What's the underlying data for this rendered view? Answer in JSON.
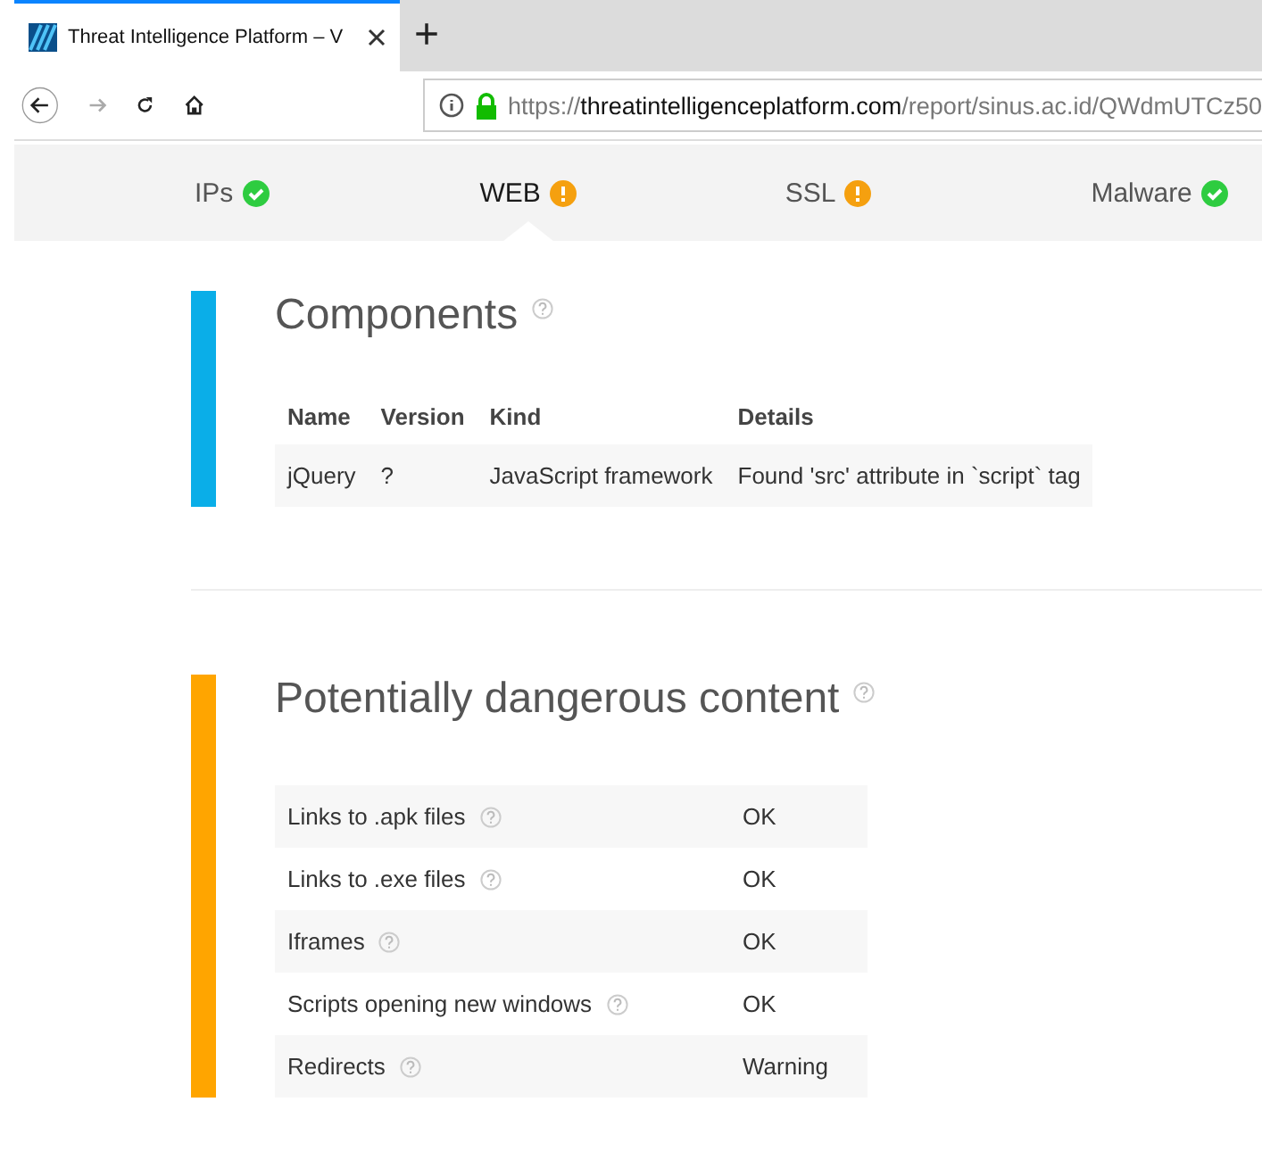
{
  "browser": {
    "tab_title": "Threat Intelligence Platform – V",
    "new_tab": "+",
    "url": {
      "scheme": "https://",
      "host": "threatintelligenceplatform.com",
      "path": "/report/sinus.ac.id/QWdmUTCz50"
    }
  },
  "categories": [
    {
      "label": "IPs",
      "kind": "ok",
      "selected": false
    },
    {
      "label": "WEB",
      "kind": "warning",
      "selected": true
    },
    {
      "label": "SSL",
      "kind": "warning",
      "selected": false
    },
    {
      "label": "Malware",
      "kind": "ok",
      "selected": false
    }
  ],
  "components": {
    "title": "Components",
    "color": "#0aaee8",
    "columns": [
      "Name",
      "Version",
      "Kind",
      "Details"
    ],
    "rows": [
      [
        "jQuery",
        "?",
        "JavaScript framework",
        "Found 'src' attribute in `script` tag"
      ]
    ]
  },
  "dangerous_content": {
    "title": "Potentially dangerous content",
    "color": "#ffa500",
    "rows": [
      {
        "label": "Links to .apk files",
        "value": "OK"
      },
      {
        "label": "Links to .exe files",
        "value": "OK"
      },
      {
        "label": "Iframes",
        "value": "OK"
      },
      {
        "label": "Scripts opening new windows",
        "value": "OK"
      },
      {
        "label": "Redirects",
        "value": "Warning"
      }
    ]
  }
}
